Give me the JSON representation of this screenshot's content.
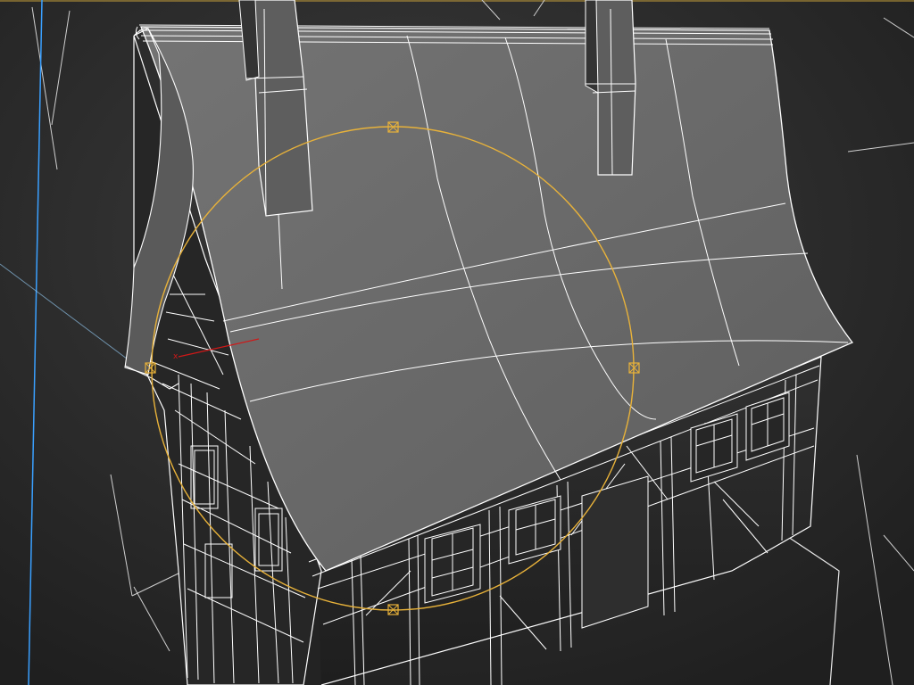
{
  "viewport": {
    "view_label": "",
    "background_color": "#2b2b2b",
    "wire_color": "#ffffff",
    "gizmo_color": "#e8b23a",
    "axis_x_color": "#d01818",
    "axis_y_color": "#3aa0ff"
  },
  "scene": {
    "object": "half-timbered-house",
    "selected_part": "roof",
    "gizmo": "rotate-gizmo",
    "parts": [
      "roof",
      "chimney-left",
      "chimney-right",
      "front-gable",
      "side-wall",
      "windows",
      "timber-frame",
      "ground-outline"
    ]
  }
}
